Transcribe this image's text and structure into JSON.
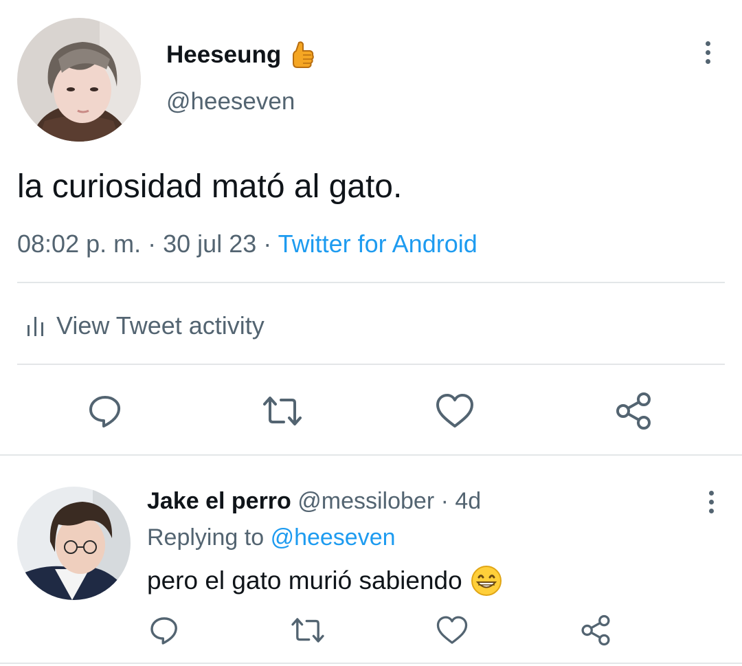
{
  "tweet": {
    "author_name": "Heeseung",
    "author_emoji": "thumbs-up",
    "author_handle": "@heeseven",
    "text": "la curiosidad mató al gato.",
    "time": "08:02 p. m.",
    "sep1": "·",
    "date": "30 jul 23",
    "sep2": "·",
    "source": "Twitter for Android",
    "activity_label": "View Tweet activity",
    "actions": [
      "reply",
      "retweet",
      "like",
      "share"
    ]
  },
  "reply": {
    "author_name": "Jake el perro",
    "author_handle": "@messilober",
    "sep": "·",
    "age": "4d",
    "replying_prefix": "Replying to",
    "replying_handle": "@heeseven",
    "text": "pero el gato murió sabiendo",
    "text_emoji": "grinning-face",
    "actions": [
      "reply",
      "retweet",
      "like",
      "share"
    ]
  },
  "colors": {
    "accent": "#1d9bf0",
    "muted": "#536471",
    "divider": "#e3e6e8"
  }
}
